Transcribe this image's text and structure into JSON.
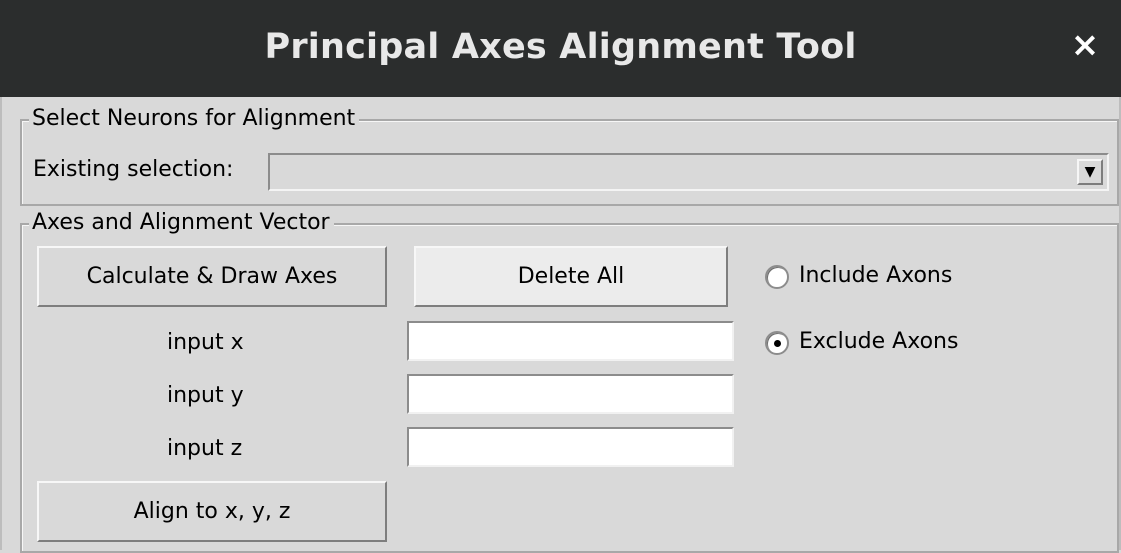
{
  "window": {
    "title": "Principal Axes Alignment Tool",
    "close_glyph": "×"
  },
  "neuron_selection": {
    "legend": "Select Neurons for Alignment",
    "existing_label": "Existing selection:",
    "existing_value": "",
    "dropdown_glyph": "▼"
  },
  "axes": {
    "legend": "Axes and Alignment Vector",
    "calculate_button": "Calculate & Draw Axes",
    "delete_button": "Delete All",
    "include_axons": "Include Axons",
    "exclude_axons": "Exclude Axons",
    "axon_mode_selected": "exclude",
    "input_x_label": "input x",
    "input_y_label": "input y",
    "input_z_label": "input z",
    "input_x_value": "",
    "input_y_value": "",
    "input_z_value": "",
    "align_button": "Align to x, y, z"
  }
}
